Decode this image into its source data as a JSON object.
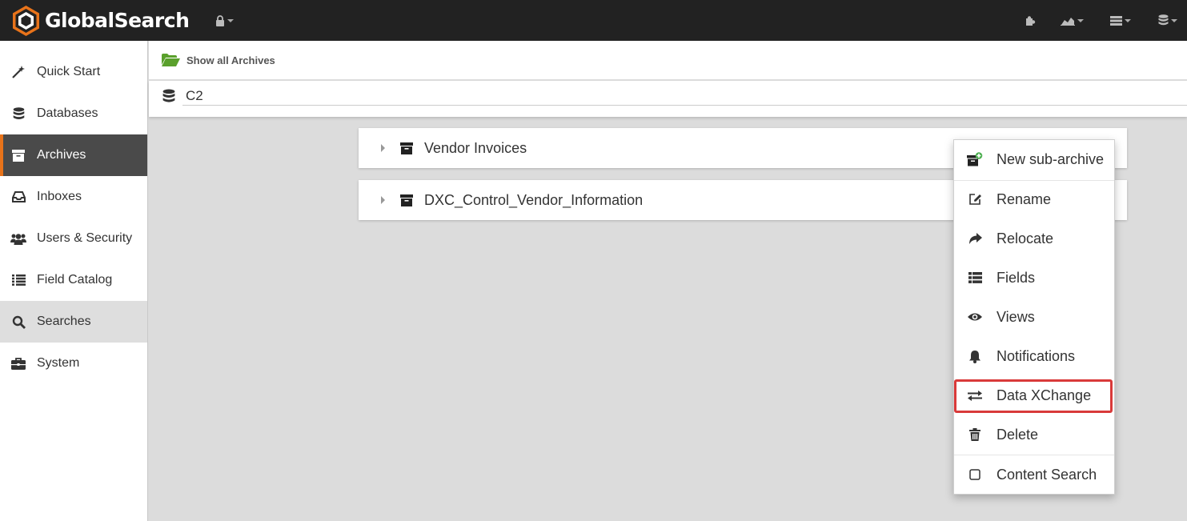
{
  "app": {
    "title": "GlobalSearch"
  },
  "topbar": {
    "icons": [
      "lock-icon",
      "puzzle-icon",
      "chart-icon",
      "list-icon",
      "database-icon"
    ]
  },
  "sidebar": {
    "items": [
      {
        "label": "Quick Start",
        "icon": "magic-wand-icon"
      },
      {
        "label": "Databases",
        "icon": "database-icon"
      },
      {
        "label": "Archives",
        "icon": "archive-icon",
        "active": true
      },
      {
        "label": "Inboxes",
        "icon": "inbox-icon"
      },
      {
        "label": "Users & Security",
        "icon": "users-icon"
      },
      {
        "label": "Field Catalog",
        "icon": "list-icon"
      },
      {
        "label": "Searches",
        "icon": "search-icon",
        "hover": true
      },
      {
        "label": "System",
        "icon": "briefcase-icon"
      }
    ]
  },
  "header": {
    "show_all": "Show all Archives"
  },
  "database": {
    "name": "C2"
  },
  "archives": [
    {
      "label": "Vendor Invoices"
    },
    {
      "label": "DXC_Control_Vendor_Information"
    }
  ],
  "context_menu": {
    "items": [
      {
        "label": "New sub-archive",
        "icon": "new-archive-icon"
      },
      {
        "label": "Rename",
        "icon": "edit-icon"
      },
      {
        "label": "Relocate",
        "icon": "share-arrow-icon"
      },
      {
        "label": "Fields",
        "icon": "list-icon"
      },
      {
        "label": "Views",
        "icon": "eye-icon"
      },
      {
        "label": "Notifications",
        "icon": "bell-icon"
      },
      {
        "label": "Data XChange",
        "icon": "exchange-icon",
        "highlighted": true
      },
      {
        "label": "Delete",
        "icon": "trash-icon"
      },
      {
        "label": "Content Search",
        "icon": "checkbox-icon"
      }
    ]
  },
  "colors": {
    "topbar": "#222222",
    "accent": "#e8731a",
    "active_nav": "#4a4a4a",
    "folder_green": "#5aa02c",
    "highlight_red": "#d93a3a"
  }
}
